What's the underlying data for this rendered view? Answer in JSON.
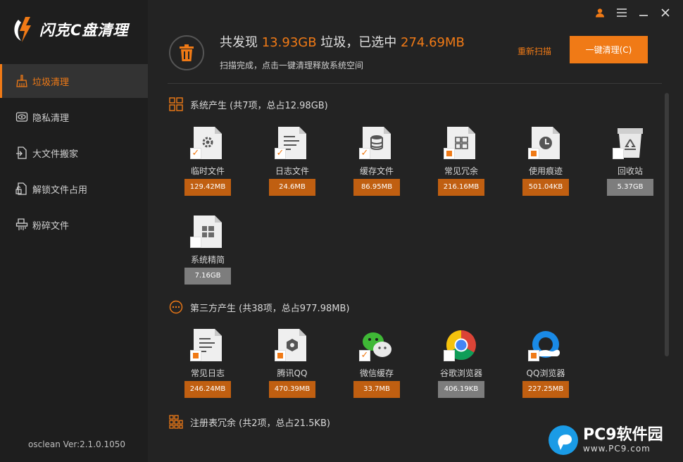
{
  "app": {
    "logo_text": "闪克C盘清理",
    "version": "osclean Ver:2.1.0.1050"
  },
  "sidebar": {
    "items": [
      {
        "label": "垃圾清理",
        "icon": "broom-icon",
        "active": true
      },
      {
        "label": "隐私清理",
        "icon": "eye-icon",
        "active": false
      },
      {
        "label": "大文件搬家",
        "icon": "move-file-icon",
        "active": false
      },
      {
        "label": "解锁文件占用",
        "icon": "unlock-file-icon",
        "active": false
      },
      {
        "label": "粉碎文件",
        "icon": "shredder-icon",
        "active": false
      }
    ]
  },
  "window_controls": {
    "user": "user-icon",
    "menu": "menu-icon",
    "minimize": "minimize-icon",
    "close": "close-icon"
  },
  "header": {
    "prefix": "共发现 ",
    "found_size": "13.93GB",
    "middle": " 垃圾，已选中 ",
    "selected_size": "274.69MB",
    "subtitle": "扫描完成，点击一键清理释放系统空间",
    "rescan_label": "重新扫描",
    "clean_label": "一键清理(C)"
  },
  "sections": [
    {
      "title": "系统产生 (共7项，总占12.98GB)",
      "icon": "grid-icon",
      "items": [
        {
          "label": "临时文件",
          "size": "129.42MB",
          "check": "full",
          "icon": "gear-file-icon"
        },
        {
          "label": "日志文件",
          "size": "24.6MB",
          "check": "full",
          "icon": "log-file-icon"
        },
        {
          "label": "缓存文件",
          "size": "86.95MB",
          "check": "full",
          "icon": "database-file-icon"
        },
        {
          "label": "常见冗余",
          "size": "216.16MB",
          "check": "part",
          "icon": "windows-file-icon"
        },
        {
          "label": "使用痕迹",
          "size": "501.04KB",
          "check": "part",
          "icon": "clock-file-icon"
        },
        {
          "label": "回收站",
          "size": "5.37GB",
          "check": "none",
          "icon": "recycle-bin-icon"
        },
        {
          "label": "系统精简",
          "size": "7.16GB",
          "check": "none",
          "icon": "windows-file-icon"
        }
      ]
    },
    {
      "title": "第三方产生 (共38项，总占977.98MB)",
      "icon": "more-circle-icon",
      "items": [
        {
          "label": "常见日志",
          "size": "246.24MB",
          "check": "part",
          "icon": "log-file-icon"
        },
        {
          "label": "腾讯QQ",
          "size": "470.39MB",
          "check": "part",
          "icon": "hexagon-file-icon"
        },
        {
          "label": "微信缓存",
          "size": "33.7MB",
          "check": "full",
          "icon": "wechat-icon"
        },
        {
          "label": "谷歌浏览器",
          "size": "406.19KB",
          "check": "none",
          "icon": "chrome-icon"
        },
        {
          "label": "QQ浏览器",
          "size": "227.25MB",
          "check": "part",
          "icon": "qq-browser-icon"
        }
      ]
    },
    {
      "title": "注册表冗余 (共2项，总占21.5KB)",
      "icon": "registry-icon",
      "items": []
    }
  ],
  "watermark": {
    "big": "PC9软件园",
    "small": "www.PC9.com"
  },
  "colors": {
    "accent": "#f07a16",
    "size_badge": "#c05f11",
    "size_badge_grey": "#7d7d7d",
    "background": "#232323"
  }
}
